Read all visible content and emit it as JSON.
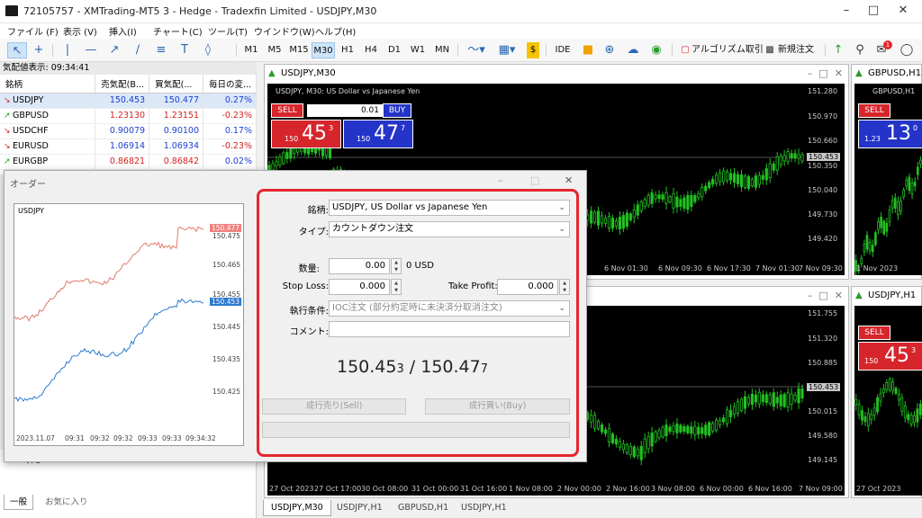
{
  "window": {
    "title": "72105757 - XMTrading-MT5 3 - Hedge - Tradexfin Limited - USDJPY,M30"
  },
  "menu": [
    "ファイル (F)",
    "表示 (V)",
    "挿入(I)",
    "チャート(C)",
    "ツール(T)",
    "ウインドウ(W)",
    "ヘルプ(H)"
  ],
  "toolbar": {
    "timeframes": [
      "M1",
      "M5",
      "M15",
      "M30",
      "H1",
      "H4",
      "D1",
      "W1",
      "MN"
    ],
    "active_timeframe": "M30",
    "ide_label": "IDE",
    "algo_label": "アルゴリズム取引",
    "new_order_label": "新規注文",
    "notification_count": "1"
  },
  "market_watch": {
    "header": "気配値表示: 09:34:41",
    "columns": [
      "銘柄",
      "売気配(B...",
      "買気配(...",
      "毎日の変..."
    ],
    "rows": [
      {
        "symbol": "USDJPY",
        "bid": "150.453",
        "ask": "150.477",
        "change": "0.27%",
        "dir": "down"
      },
      {
        "symbol": "GBPUSD",
        "bid": "1.23130",
        "ask": "1.23151",
        "change": "-0.23%",
        "dir": "up"
      },
      {
        "symbol": "USDCHF",
        "bid": "0.90079",
        "ask": "0.90100",
        "change": "0.17%",
        "dir": "down"
      },
      {
        "symbol": "EURUSD",
        "bid": "1.06914",
        "ask": "1.06934",
        "change": "-0.23%",
        "dir": "down"
      },
      {
        "symbol": "EURGBP",
        "bid": "0.86821",
        "ask": "0.86842",
        "change": "0.02%",
        "dir": "up"
      }
    ]
  },
  "lower_left": {
    "tabs": [
      "一般",
      "お気に入り"
    ],
    "item": "VPS"
  },
  "order_dialog": {
    "title": "オーダー",
    "mini_chart": {
      "symbol": "USDJPY",
      "price_labels": [
        "150.475",
        "150.465",
        "150.455",
        "150.445",
        "150.435",
        "150.425"
      ],
      "ask_tag": "150.477",
      "bid_tag": "150.453",
      "time_labels": [
        "2023.11.07",
        "09:31",
        "09:32",
        "09:32",
        "09:33",
        "09:33",
        "09:34:32"
      ]
    },
    "symbol_label": "銘柄:",
    "symbol_value": "USDJPY, US Dollar vs Japanese Yen",
    "type_label": "タイプ:",
    "type_value": "カウントダウン注文",
    "volume_label": "数量:",
    "volume_value": "0.00",
    "volume_unit": "0 USD",
    "sl_label": "Stop Loss:",
    "sl_value": "0.000",
    "tp_label": "Take Profit:",
    "tp_value": "0.000",
    "exec_label": "執行条件:",
    "exec_value": "IOC注文 (部分約定時に未決済分取消注文)",
    "comment_label": "コメント:",
    "comment_value": "",
    "bid_main": "150.45",
    "bid_small": "3",
    "sep": " / ",
    "ask_main": "150.47",
    "ask_small": "7",
    "sell_button": "成行売り(Sell)",
    "buy_button": "成行買い(Buy)"
  },
  "charts": {
    "main": {
      "tab": "USDJPY,M30",
      "header": "USDJPY, M30: US Dollar vs Japanese Yen",
      "sell": "SELL",
      "buy": "BUY",
      "lot": "0.01",
      "sell_price": {
        "pre": "150",
        "big": "45",
        "sup": "3"
      },
      "buy_price": {
        "pre": "150",
        "big": "47",
        "sup": "7"
      },
      "price_labels": [
        "151.280",
        "150.970",
        "150.660",
        "150.350",
        "150.040",
        "149.730",
        "149.420"
      ],
      "current_price": "150.453",
      "time_labels": [
        "6 Nov 01:30",
        "6 Nov 09:30",
        "6 Nov 17:30",
        "7 Nov 01:30",
        "7 Nov 09:30"
      ]
    },
    "gbp": {
      "tab": "GBPUSD,H1",
      "header": "GBPUSD,H1",
      "sell": "SELL",
      "sell_price": {
        "pre": "1.23",
        "big": "13",
        "sup": "0"
      },
      "time_labels": [
        "1 Nov 2023"
      ]
    },
    "h1": {
      "tab": "USDJPY,H1",
      "price_labels": [
        "151.755",
        "151.320",
        "150.885",
        "150.453",
        "150.015",
        "149.580",
        "149.145"
      ],
      "current_price": "150.453",
      "time_labels": [
        "27 Oct 2023",
        "27 Oct 17:00",
        "30 Oct 08:00",
        "31 Oct 00:00",
        "31 Oct 16:00",
        "1 Nov 08:00",
        "2 Nov 00:00",
        "2 Nov 16:00",
        "3 Nov 08:00",
        "6 Nov 00:00",
        "6 Nov 16:00",
        "7 Nov 09:00"
      ]
    },
    "usdjpy_h1_right": {
      "tab": "USDJPY,H1",
      "sell": "SELL",
      "sell_price": {
        "pre": "150",
        "big": "45",
        "sup": "3"
      },
      "time_labels": [
        "27 Oct 2023"
      ]
    }
  },
  "bottom_tabs": [
    "USDJPY,M30",
    "USDJPY,H1",
    "GBPUSD,H1",
    "USDJPY,H1"
  ],
  "colors": {
    "sell": "#d6252b",
    "buy": "#2434c8",
    "candle": "#22c022",
    "highlight": "#e5262c"
  }
}
